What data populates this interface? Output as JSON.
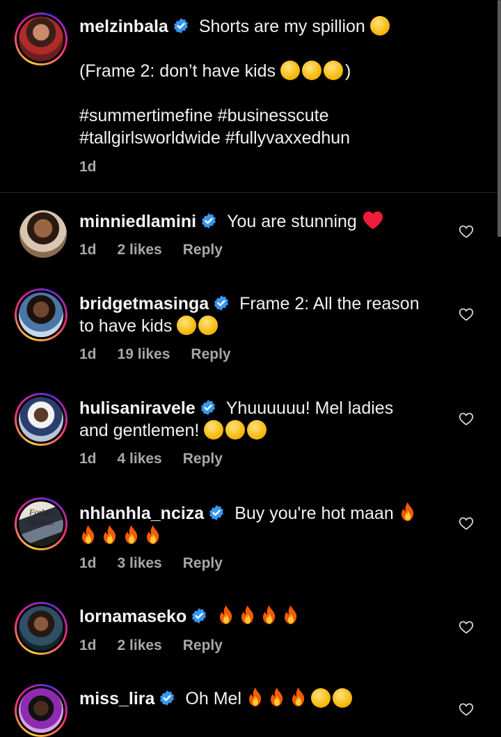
{
  "caption": {
    "username": "melzinbala",
    "line1_text": "Shorts are my spillion",
    "line2_text": "(Frame 2: don’t have kids",
    "line2_end": ")",
    "hashtags_line1": "#summertimefine #businesscute",
    "hashtags_line2": "#tallgirlsworldwide #fullyvaxxedhun",
    "time": "1d"
  },
  "comments": [
    {
      "username": "minniedlamini",
      "text": "You are stunning",
      "time": "1d",
      "likes": "2 likes",
      "reply": "Reply"
    },
    {
      "username": "bridgetmasinga",
      "text": "Frame 2: All the reason",
      "text2": "to have kids",
      "time": "1d",
      "likes": "19 likes",
      "reply": "Reply"
    },
    {
      "username": "hulisaniravele",
      "text": "Yhuuuuuu! Mel ladies",
      "text2": "and gentlemen!",
      "time": "1d",
      "likes": "4 likes",
      "reply": "Reply"
    },
    {
      "username": "nhlanhla_nciza",
      "text": "Buy you're hot maan",
      "time": "1d",
      "likes": "3 likes",
      "reply": "Reply"
    },
    {
      "username": "lornamaseko",
      "text": "",
      "time": "1d",
      "likes": "2 likes",
      "reply": "Reply"
    },
    {
      "username": "miss_lira",
      "text": "Oh Mel"
    }
  ],
  "avatar_badge_text": "Forbes Woman",
  "colors": {
    "background": "#000000",
    "verified": "#3897f0",
    "meta": "#a8a8a8",
    "heart_red": "#ed1c3a"
  }
}
